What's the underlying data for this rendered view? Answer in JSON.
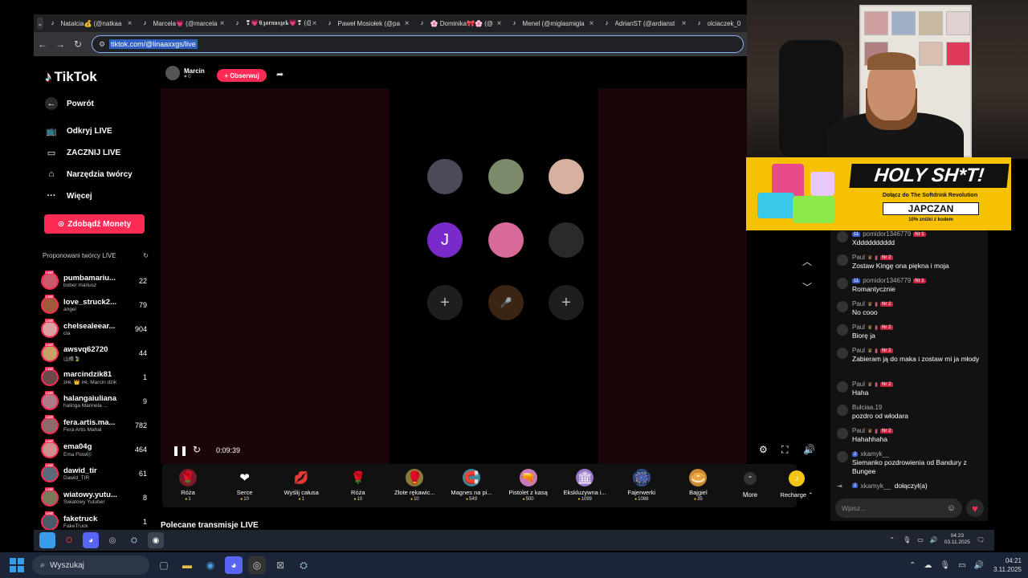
{
  "browser": {
    "tabs": [
      {
        "label": "Natalcia💰 (@natkaa"
      },
      {
        "label": "Marcela💗 (@marcela"
      },
      {
        "label": "❣💗𝕮𝖟𝖆𝖗𝖓𝖚𝖘𝖟𝖊𝖐💗❣ (@"
      },
      {
        "label": "Paweł Mosiołek (@pa"
      },
      {
        "label": "🌸 Dominika🎀🌸 (@"
      },
      {
        "label": "Menel (@miglasmigla"
      },
      {
        "label": "AdrianST (@ardianst"
      },
      {
        "label": "olciaczek_0"
      }
    ],
    "url": "tiktok.com/@linaaxxgs/live"
  },
  "tiktok": {
    "logo": "TikTok",
    "nav": [
      {
        "label": "Powrót",
        "icon": "back-arrow-icon"
      },
      {
        "label": "Odkryj LIVE",
        "icon": "tv-icon"
      },
      {
        "label": "ZACZNIJ LIVE",
        "icon": "camera-icon"
      },
      {
        "label": "Narzędzia twórcy",
        "icon": "home-tools-icon"
      },
      {
        "label": "Więcej",
        "icon": "more-dots-icon"
      }
    ],
    "coins_button": "Zdobądź Monety",
    "suggested_header": "Proponowani twórcy LIVE",
    "creators": [
      {
        "name": "pumbamariu...",
        "sub": "bober mariusz",
        "count": "22",
        "color": "#c85a6a"
      },
      {
        "name": "love_struck2...",
        "sub": "angel",
        "count": "79",
        "color": "#a05a3a"
      },
      {
        "name": "chelsealeear...",
        "sub": "cla",
        "count": "904",
        "color": "#d8a0a0"
      },
      {
        "name": "awsvq62720",
        "sub": "山楂🍃",
        "count": "44",
        "color": "#c8a068"
      },
      {
        "name": "marcindzik81",
        "sub": "ɪᴘʀ. 👑 ᴘʀ. Marcin dzik",
        "count": "1",
        "color": "#6a4a4a"
      },
      {
        "name": "halangaiuliana",
        "sub": "halinga Marinela ...",
        "count": "9",
        "color": "#b07a8a"
      },
      {
        "name": "fera.artis.ma...",
        "sub": "Fera Artis Mahal",
        "count": "782",
        "color": "#8a6a6a"
      },
      {
        "name": "ema04g",
        "sub": "Ema Flow🎼",
        "count": "464",
        "color": "#d09090"
      },
      {
        "name": "dawid_tir",
        "sub": "Dawid_TIR",
        "count": "61",
        "color": "#5a6a7a"
      },
      {
        "name": "wiatowy.yutu...",
        "sub": "Światowy Yutuber",
        "count": "8",
        "color": "#7a7a5a"
      },
      {
        "name": "faketruck",
        "sub": "FakeTruck",
        "count": "1",
        "color": "#4a5a6a"
      }
    ],
    "host": {
      "name": "Marcin",
      "sub": "♥ 0"
    },
    "follow_button": "+ Obserwuj",
    "timer": "0:09:39",
    "seat_letter": "J",
    "gifts": [
      {
        "name": "Róża",
        "price": "1",
        "icon": "🌹",
        "bg": "#7a1a2a"
      },
      {
        "name": "Serce",
        "price": "10",
        "icon": "❤",
        "bg": "transparent"
      },
      {
        "name": "Wyślij całusa",
        "price": "1",
        "icon": "💋",
        "bg": "transparent"
      },
      {
        "name": "Róża",
        "price": "10",
        "icon": "🌹",
        "bg": "transparent"
      },
      {
        "name": "Złote rękawic...",
        "price": "10",
        "icon": "🥊",
        "bg": "#8a7a3a"
      },
      {
        "name": "Magnes na pi...",
        "price": "549",
        "icon": "🧲",
        "bg": "#3a8a9a"
      },
      {
        "name": "Pistolet z kasą",
        "price": "500",
        "icon": "🔫",
        "bg": "#c87ab8"
      },
      {
        "name": "Ekskluzywna i...",
        "price": "1099",
        "icon": "🏛",
        "bg": "#9a7ac8"
      },
      {
        "name": "Fajerwerki",
        "price": "1088",
        "icon": "🎆",
        "bg": "#3a4a8a"
      },
      {
        "name": "Bajgiel",
        "price": "35",
        "icon": "🥯",
        "bg": "#c8883a"
      }
    ],
    "more_label": "More",
    "recharge_label": "Recharge ⌃",
    "recommended_label": "Polecane transmisje LIVE"
  },
  "ad": {
    "title": "HOLY SH*T!",
    "subtitle": "Dołącz do The Softdrink Revolution",
    "code": "JAPCZAN",
    "discount": "10% zniżki z kodem"
  },
  "chat": {
    "messages": [
      {
        "user": "pomidor1346779",
        "level": "11",
        "fan": "Nr 1",
        "text": "Xdddddddddd",
        "crown": false
      },
      {
        "user": "Paul",
        "level": "",
        "fan": "Nr 2",
        "text": "Zostaw Kingę ona piękna i moja",
        "crown": true
      },
      {
        "user": "pomidor1346779",
        "level": "11",
        "fan": "Nr 1",
        "text": "Romantycznie",
        "crown": false
      },
      {
        "user": "Paul",
        "level": "",
        "fan": "Nr 2",
        "text": "No cooo",
        "crown": true
      },
      {
        "user": "Paul",
        "level": "",
        "fan": "Nr 2",
        "text": "Biorę ja",
        "crown": true
      },
      {
        "user": "Paul",
        "level": "",
        "fan": "Nr 2",
        "text": "Zabieram ją do maka i zostaw mi ja młody",
        "crown": true
      },
      {
        "user": "Paul",
        "level": "",
        "fan": "Nr 2",
        "text": "Haha",
        "crown": true
      },
      {
        "user": "Bułciaa.19",
        "level": "",
        "fan": "",
        "text": "pozdro od włodara",
        "crown": false
      },
      {
        "user": "Paul",
        "level": "",
        "fan": "Nr 2",
        "text": "Hahahhaha",
        "crown": true
      },
      {
        "user": "xkamyk__",
        "level": "2",
        "fan": "",
        "text": "Siemanko pozdrowienia od Bandury z Bungee",
        "crown": false
      }
    ],
    "joined": {
      "level": "2",
      "user": "xkamyk__",
      "text": "dołączył(a)"
    },
    "input_placeholder": "Wpisz..."
  },
  "inner_taskbar": {
    "time": "04:23",
    "date": "03.11.2025"
  },
  "taskbar": {
    "search_label": "Wyszukaj",
    "time": "04:21",
    "date": "3.11.2025"
  }
}
